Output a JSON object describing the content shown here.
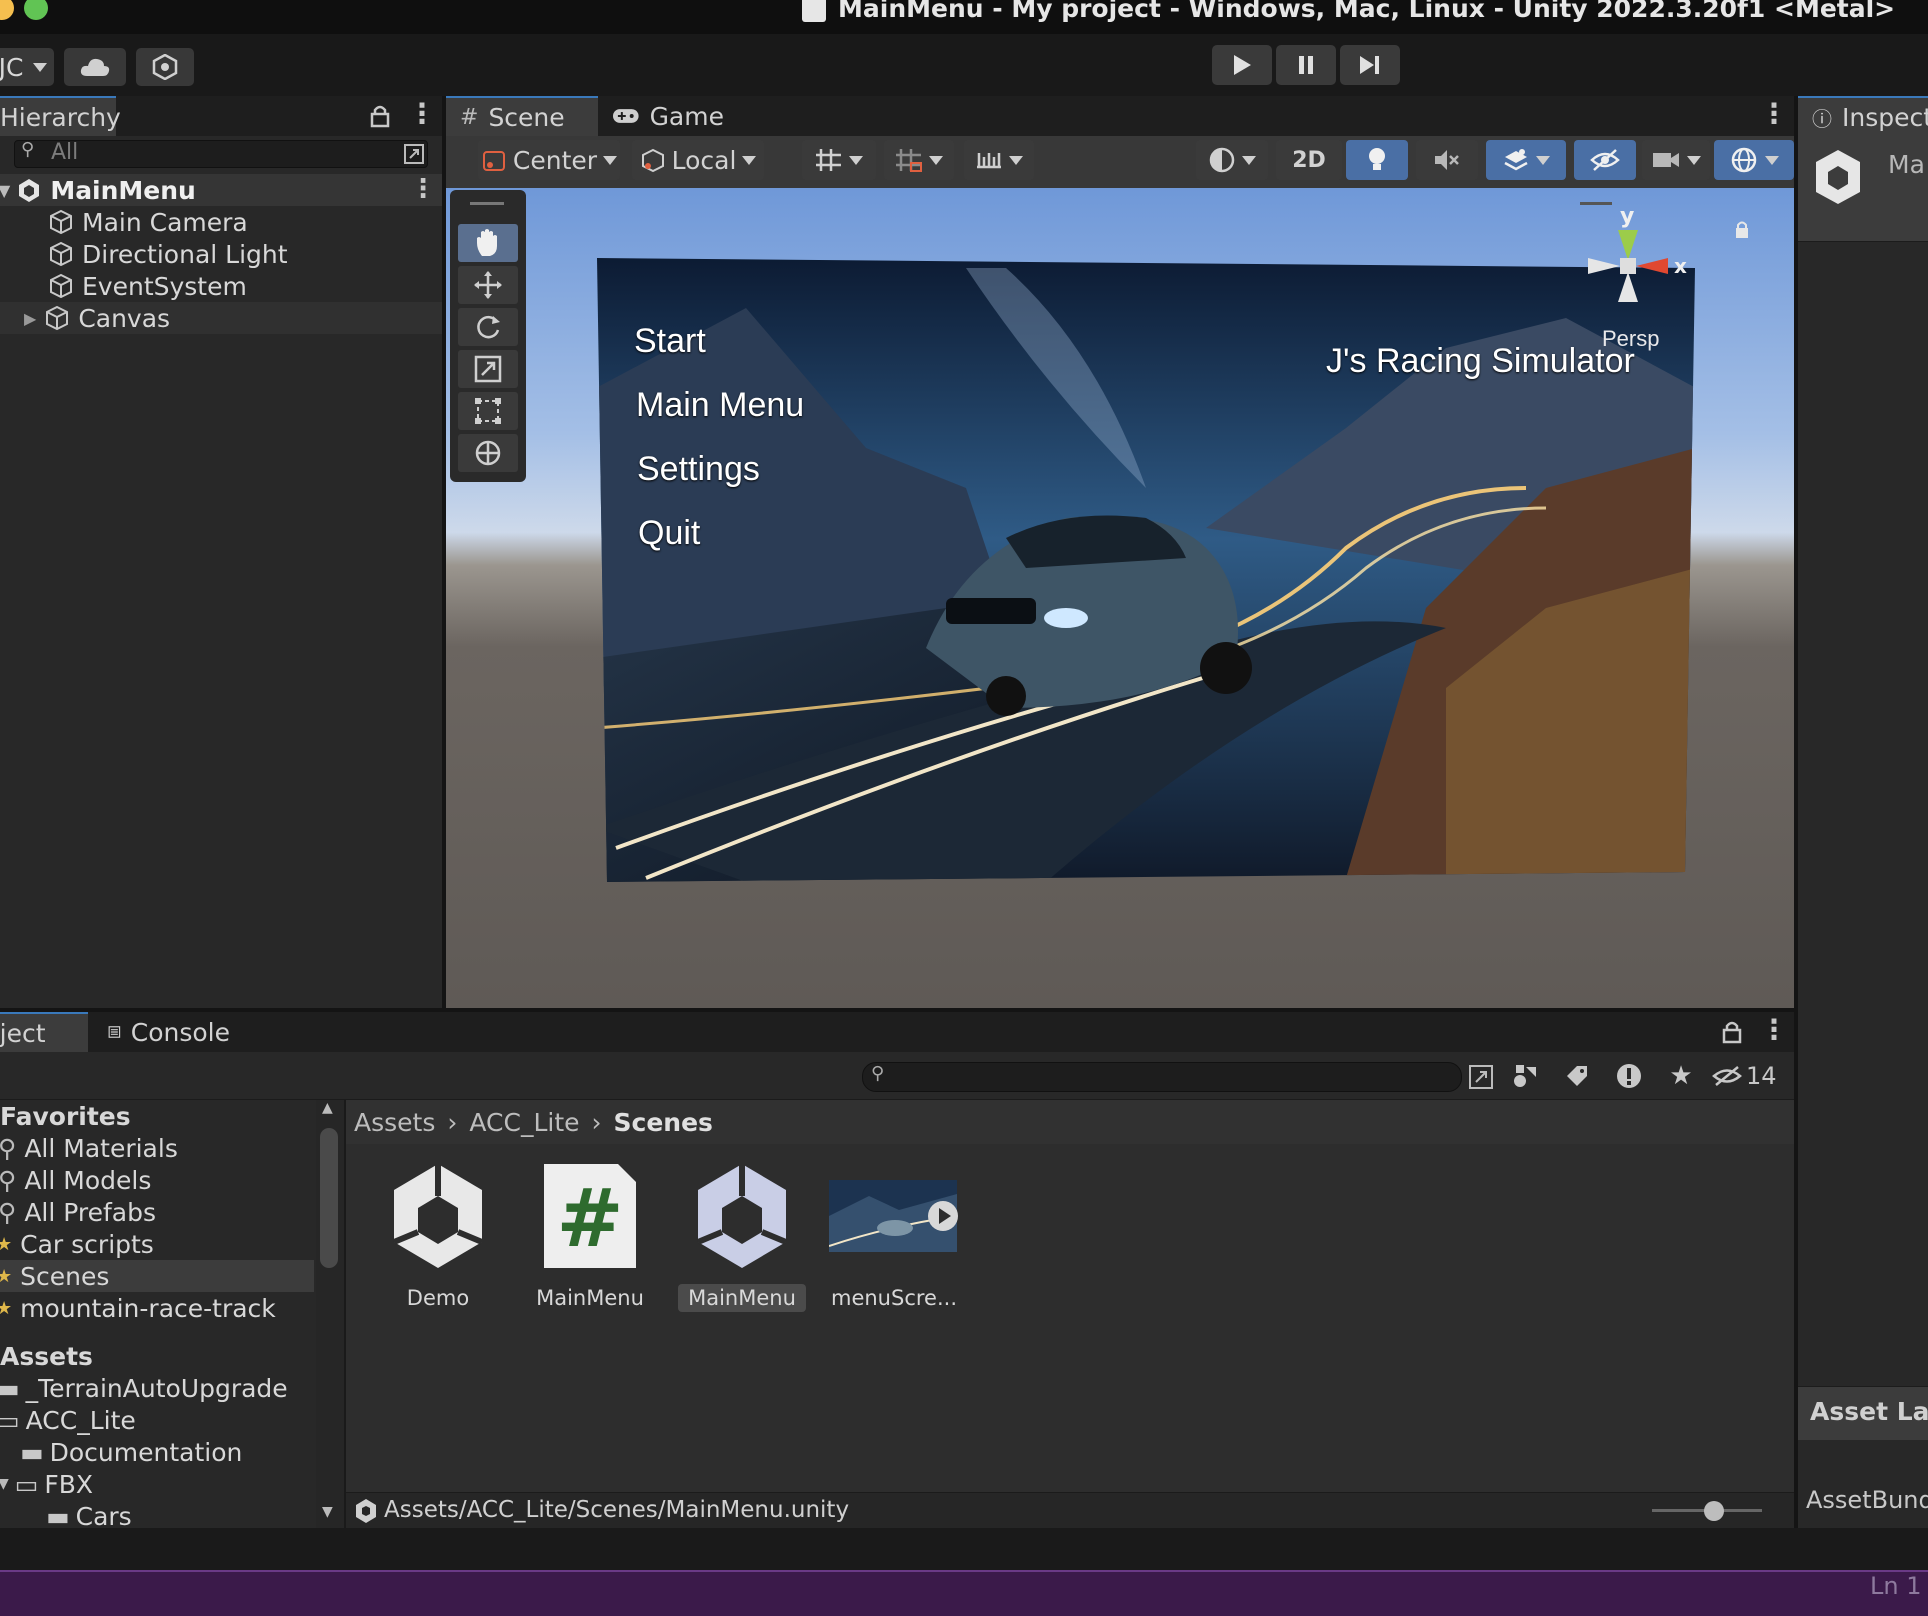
{
  "window": {
    "title": "MainMenu - My project - Windows, Mac, Linux - Unity 2022.3.20f1 <Metal>"
  },
  "toolbar": {
    "account_label": "JC",
    "play_icon": "play-icon",
    "pause_icon": "pause-icon",
    "step_icon": "step-icon"
  },
  "hierarchy": {
    "tab_label": "Hierarchy",
    "search_placeholder": "All",
    "scene_name": "MainMenu",
    "items": [
      {
        "label": "Main Camera"
      },
      {
        "label": "Directional Light"
      },
      {
        "label": "EventSystem"
      },
      {
        "label": "Canvas"
      }
    ]
  },
  "scene_view": {
    "tabs": [
      {
        "label": "Scene"
      },
      {
        "label": "Game"
      }
    ],
    "pivot_mode": "Center",
    "pivot_rotation": "Local",
    "mode_2d": "2D",
    "gizmo_axes": {
      "y": "y",
      "x": "x",
      "projection": "Persp"
    }
  },
  "game_ui": {
    "title": "J's Racing Simulator",
    "menu": [
      "Start",
      "Main Menu",
      "Settings",
      "Quit"
    ]
  },
  "inspector": {
    "tab_label": "Inspector",
    "object_name": "Ma",
    "asset_labels_header": "Asset Lab",
    "asset_bundle": "AssetBund"
  },
  "project": {
    "tabs": [
      {
        "label": "Project"
      },
      {
        "label": "Console"
      }
    ],
    "hidden_count": "14",
    "favorites_header": "Favorites",
    "favorites": [
      "All Materials",
      "All Models",
      "All Prefabs",
      "Car scripts",
      "Scenes",
      "mountain-race-track"
    ],
    "assets_header": "Assets",
    "assets_tree": [
      "_TerrainAutoUpgrade",
      "ACC_Lite",
      "Documentation",
      "FBX",
      "Cars"
    ],
    "breadcrumb": [
      "Assets",
      "ACC_Lite",
      "Scenes"
    ],
    "files": [
      {
        "label": "Demo"
      },
      {
        "label": "MainMenu"
      },
      {
        "label": "MainMenu"
      },
      {
        "label": "menuScre..."
      }
    ],
    "status_path": "Assets/ACC_Lite/Scenes/MainMenu.unity"
  },
  "statusbar": {
    "right_text": "Ln 1"
  },
  "colors": {
    "accent": "#3a79bb",
    "panel_bg": "#282828",
    "selection": "#2c5d87",
    "footer_purple": "#3b1a4a"
  }
}
